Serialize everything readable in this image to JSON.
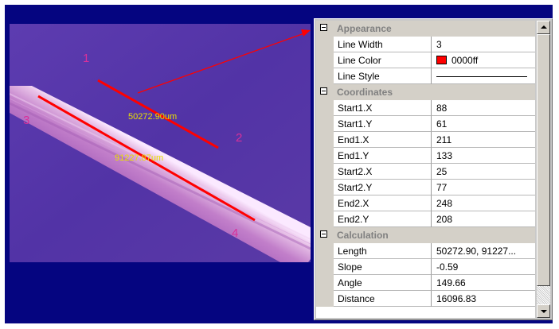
{
  "image": {
    "points": [
      "1",
      "2",
      "3",
      "4"
    ],
    "measurements": [
      "50272.90um",
      "91227.87um"
    ],
    "line_color": "#ff0000",
    "point_label_color": "#d9309a",
    "measurement_color": "#e8e000"
  },
  "properties": {
    "appearance": {
      "title": "Appearance",
      "line_width_label": "Line Width",
      "line_width": "3",
      "line_color_label": "Line Color",
      "line_color": "0000ff",
      "line_color_swatch": "#ff0000",
      "line_style_label": "Line Style"
    },
    "coordinates": {
      "title": "Coordinates",
      "start1_x_label": "Start1.X",
      "start1_x": "88",
      "start1_y_label": "Start1.Y",
      "start1_y": "61",
      "end1_x_label": "End1.X",
      "end1_x": "211",
      "end1_y_label": "End1.Y",
      "end1_y": "133",
      "start2_x_label": "Start2.X",
      "start2_x": "25",
      "start2_y_label": "Start2.Y",
      "start2_y": "77",
      "end2_x_label": "End2.X",
      "end2_x": "248",
      "end2_y_label": "End2.Y",
      "end2_y": "208"
    },
    "calculation": {
      "title": "Calculation",
      "length_label": "Length",
      "length": "50272.90, 91227...",
      "slope_label": "Slope",
      "slope": "-0.59",
      "angle_label": "Angle",
      "angle": "149.66",
      "distance_label": "Distance",
      "distance": "16096.83"
    }
  }
}
